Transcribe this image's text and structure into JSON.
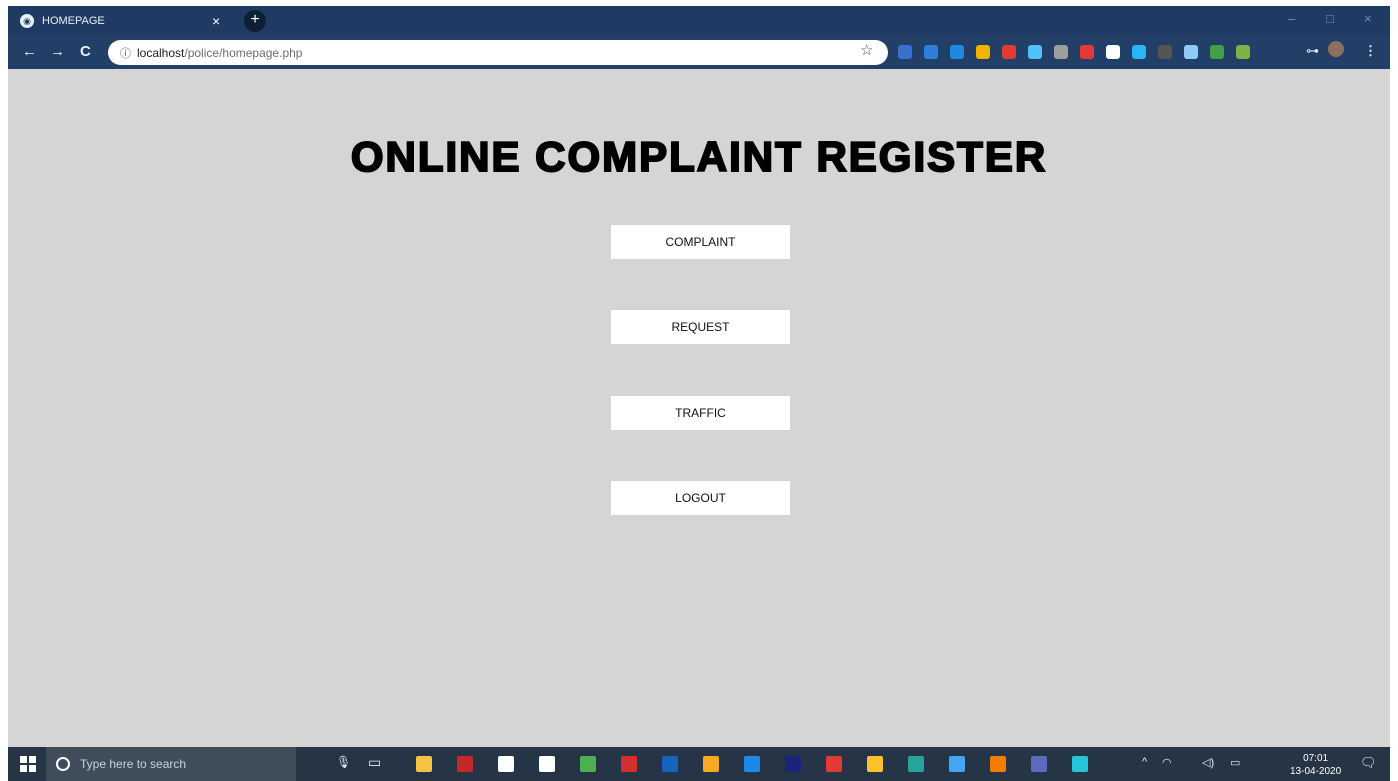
{
  "browser": {
    "tab": {
      "title": "HOMEPAGE",
      "close_label": "×",
      "new_tab_label": "+"
    },
    "window_controls": {
      "minimize": "–",
      "maximize": "□",
      "close": "×"
    },
    "nav": {
      "back": "←",
      "forward": "→",
      "reload": "C"
    },
    "address": {
      "info_icon": "ⓘ",
      "host": "localhost",
      "path": "/police/homepage.php"
    },
    "bookmark_star": "☆",
    "extension_colors": [
      "#3b6fd1",
      "#2f7fd6",
      "#1e88e5",
      "#f2b300",
      "#e53935",
      "#4fc3f7",
      "#9e9e9e",
      "#e53935",
      "#ffffff",
      "#29b6f6",
      "#555555",
      "#90caf9",
      "#43a047",
      "#7cb342"
    ],
    "key_icon": "⊶",
    "menu_icon": "⋮"
  },
  "page": {
    "title": "ONLINE COMPLAINT REGISTER",
    "buttons": [
      {
        "label": "COMPLAINT"
      },
      {
        "label": "REQUEST"
      },
      {
        "label": "TRAFFIC"
      },
      {
        "label": "LOGOUT"
      }
    ]
  },
  "taskbar": {
    "search_placeholder": "Type here to search",
    "mic_icon": "🎙",
    "task_view_icon": "▭",
    "app_colors": [
      "#f6c343",
      "#c62828",
      "#ffffff",
      "#ffffff",
      "#4caf50",
      "#d32f2f",
      "#1565c0",
      "#f9a825",
      "#1e88e5",
      "#1a237e",
      "#e53935",
      "#fbc02d",
      "#26a69a",
      "#42a5f5",
      "#f57c00",
      "#5c6bc0",
      "#26c6da"
    ],
    "tray": {
      "chevron": "^",
      "network": "◠",
      "volume": "◁)",
      "battery": "▭"
    },
    "clock": {
      "time": "07:01",
      "date": "13-04-2020"
    },
    "notifications_icon": "🗨"
  }
}
